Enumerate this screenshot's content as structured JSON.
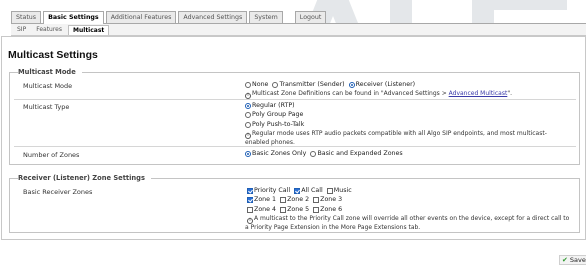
{
  "tabs": [
    {
      "label": "Status",
      "active": false
    },
    {
      "label": "Basic Settings",
      "active": true
    },
    {
      "label": "Additional Features",
      "active": false
    },
    {
      "label": "Advanced Settings",
      "active": false
    },
    {
      "label": "System",
      "active": false
    },
    {
      "label": "Logout",
      "active": false
    }
  ],
  "subtabs": [
    {
      "label": "SIP",
      "active": false
    },
    {
      "label": "Features",
      "active": false
    },
    {
      "label": "Multicast",
      "active": true
    }
  ],
  "page_title": "Multicast Settings",
  "multicast_mode_section": {
    "legend": "Multicast Mode",
    "mode": {
      "label": "Multicast Mode",
      "options": [
        "None",
        "Transmitter (Sender)",
        "Receiver (Listener)"
      ],
      "selected": "Receiver (Listener)",
      "help_prefix": "Multicast Zone Definitions can be found in \"Advanced Settings > ",
      "help_link": "Advanced Multicast",
      "help_suffix": "\"."
    },
    "type": {
      "label": "Multicast Type",
      "options": [
        "Regular (RTP)",
        "Poly Group Page",
        "Poly Push-to-Talk"
      ],
      "selected": "Regular (RTP)",
      "help_line1": "Regular mode uses RTP audio packets compatible with all Algo SIP endpoints, and most multicast-",
      "help_line2": "enabled phones."
    },
    "zones": {
      "label": "Number of Zones",
      "options": [
        "Basic Zones Only",
        "Basic and Expanded Zones"
      ],
      "selected": "Basic Zones Only"
    }
  },
  "receiver_section": {
    "legend": "Receiver (Listener) Zone Settings",
    "label": "Basic Receiver Zones",
    "zones": [
      {
        "label": "Priority Call",
        "checked": true
      },
      {
        "label": "All Call",
        "checked": true
      },
      {
        "label": "Music",
        "checked": false
      },
      {
        "label": "Zone 1",
        "checked": true
      },
      {
        "label": "Zone 2",
        "checked": false
      },
      {
        "label": "Zone 3",
        "checked": false
      },
      {
        "label": "Zone 4",
        "checked": false
      },
      {
        "label": "Zone 5",
        "checked": false
      },
      {
        "label": "Zone 6",
        "checked": false
      }
    ],
    "help_line1": "A multicast to the Priority Call zone will override all other events on the device, except for a direct call to",
    "help_line2": "a Priority Page Extension in the More Page Extensions tab."
  },
  "save_label": "Save",
  "colors": {
    "accent": "#1f5fb5",
    "save_check": "#2e9a2e",
    "link": "#3a3aa8"
  },
  "icons": {
    "info": "info-icon",
    "save": "check-icon",
    "logo": "watermark-logo"
  }
}
